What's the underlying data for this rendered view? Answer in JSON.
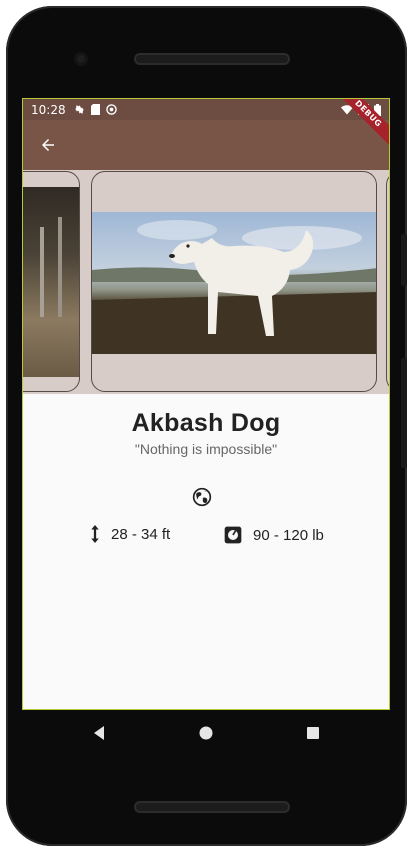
{
  "status_bar": {
    "time": "10:28",
    "icons_left": [
      "gear-icon",
      "sd-card-icon",
      "sync-icon"
    ],
    "icons_right": [
      "wifi-icon",
      "signal-icon",
      "battery-icon"
    ]
  },
  "app_bar": {
    "back_icon": "arrow-left-icon",
    "debug_label": "DEBUG",
    "color": "#795548"
  },
  "carousel": {
    "background": "#d7ccc8",
    "images": [
      "dog-photo-previous",
      "akbash-dog-photo",
      "dog-photo-next"
    ]
  },
  "breed": {
    "name": "Akbash Dog",
    "motto": "\"Nothing is impossible\"",
    "origin_icon": "globe-icon",
    "height_icon": "vertical-arrows-icon",
    "height": "28 - 34 ft",
    "weight_icon": "scale-icon",
    "weight": "90 - 120 lb"
  },
  "nav_bar": {
    "back": "triangle-back-icon",
    "home": "circle-home-icon",
    "recent": "square-recent-icon"
  }
}
